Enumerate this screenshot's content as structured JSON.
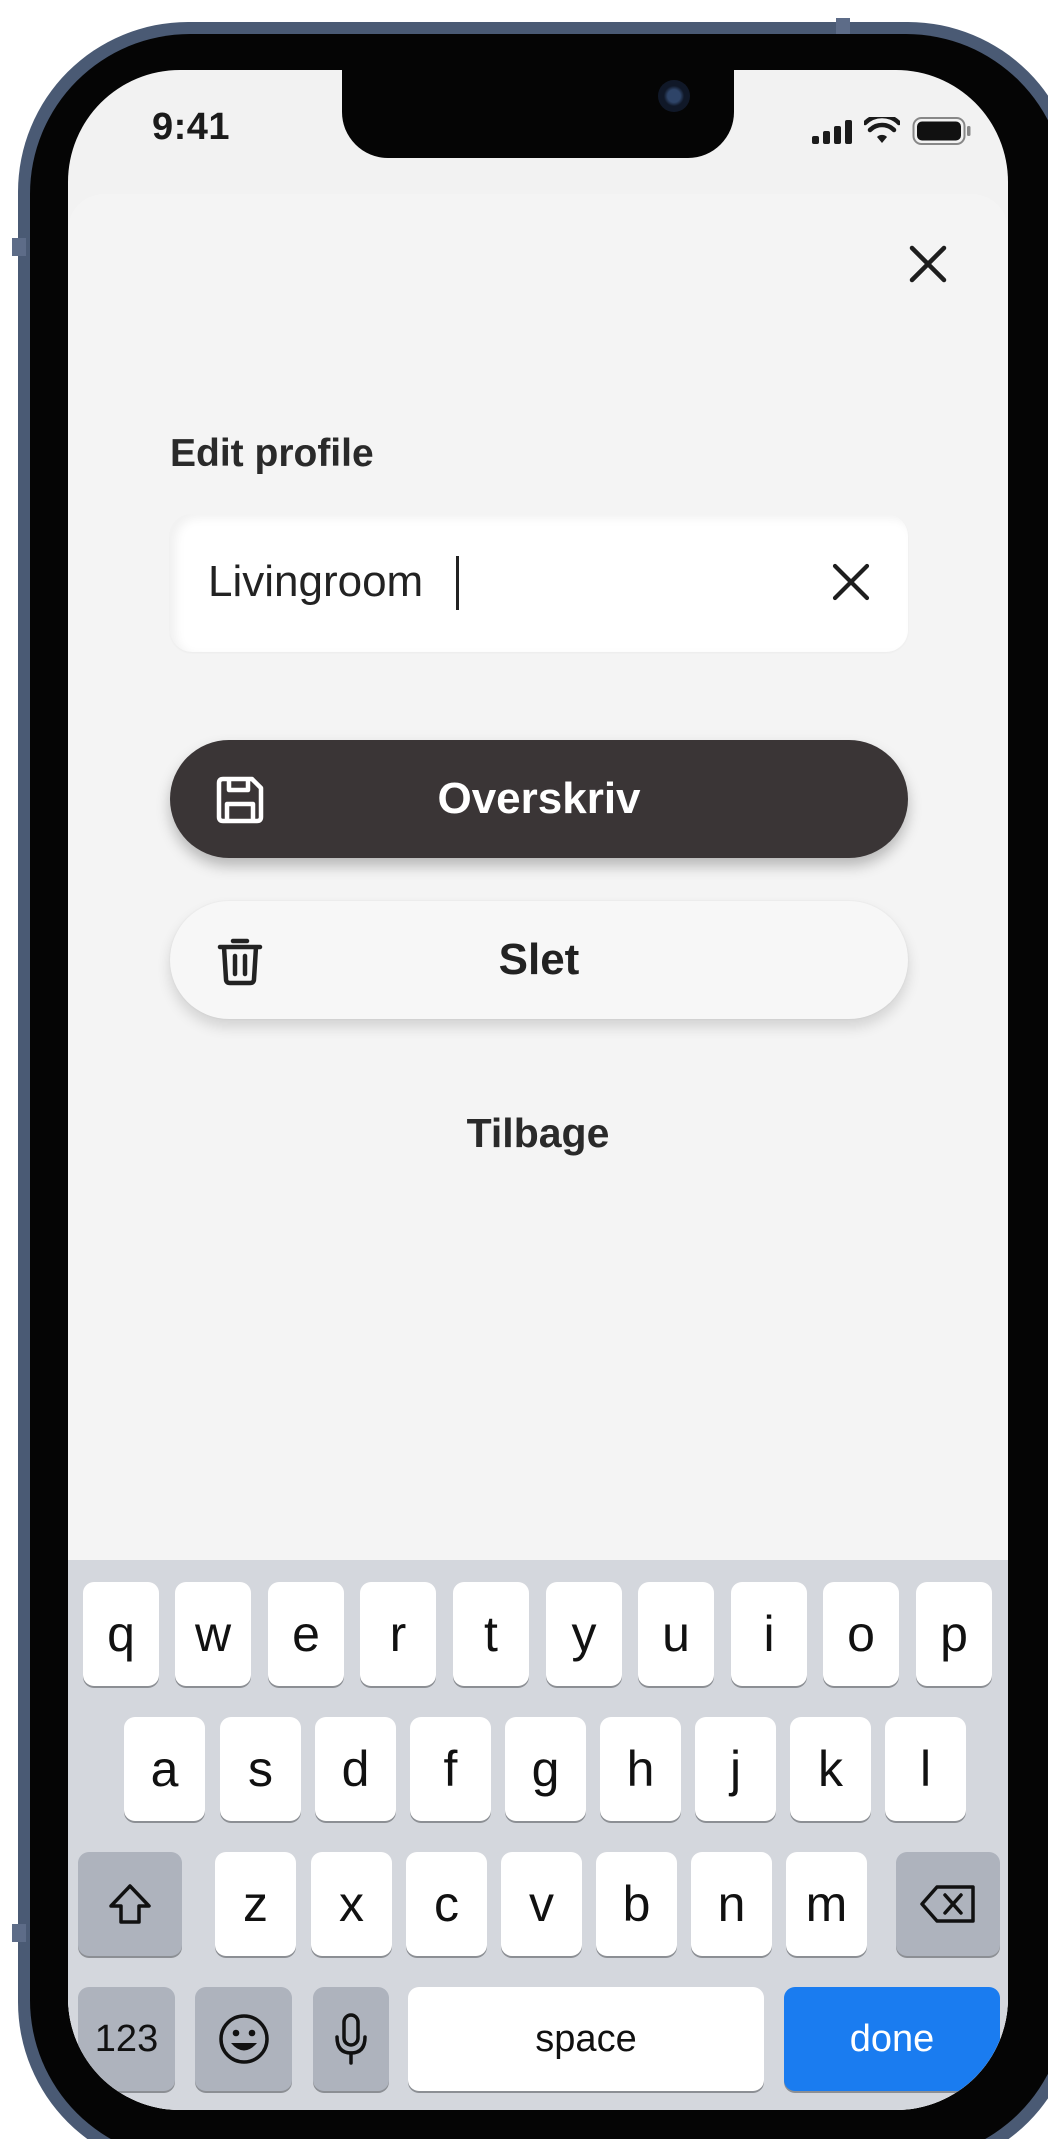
{
  "status_bar": {
    "time": "9:41"
  },
  "sheet": {
    "title": "Edit profile",
    "name_input": {
      "value": "Livingroom"
    },
    "primary_button": {
      "label": "Overskriv",
      "icon": "save-icon"
    },
    "secondary_button": {
      "label": "Slet",
      "icon": "trash-icon"
    },
    "back_link": "Tilbage"
  },
  "keyboard": {
    "row1": [
      "q",
      "w",
      "e",
      "r",
      "t",
      "y",
      "u",
      "i",
      "o",
      "p"
    ],
    "row2": [
      "a",
      "s",
      "d",
      "f",
      "g",
      "h",
      "j",
      "k",
      "l"
    ],
    "row3": [
      "z",
      "x",
      "c",
      "v",
      "b",
      "n",
      "m"
    ],
    "numbers_label": "123",
    "space_label": "space",
    "done_label": "done"
  },
  "colors": {
    "primary_button_bg": "#3a3536",
    "done_key_bg": "#1a7cf0",
    "sheet_bg": "#f4f4f4",
    "keyboard_bg": "#d4d7dd"
  }
}
